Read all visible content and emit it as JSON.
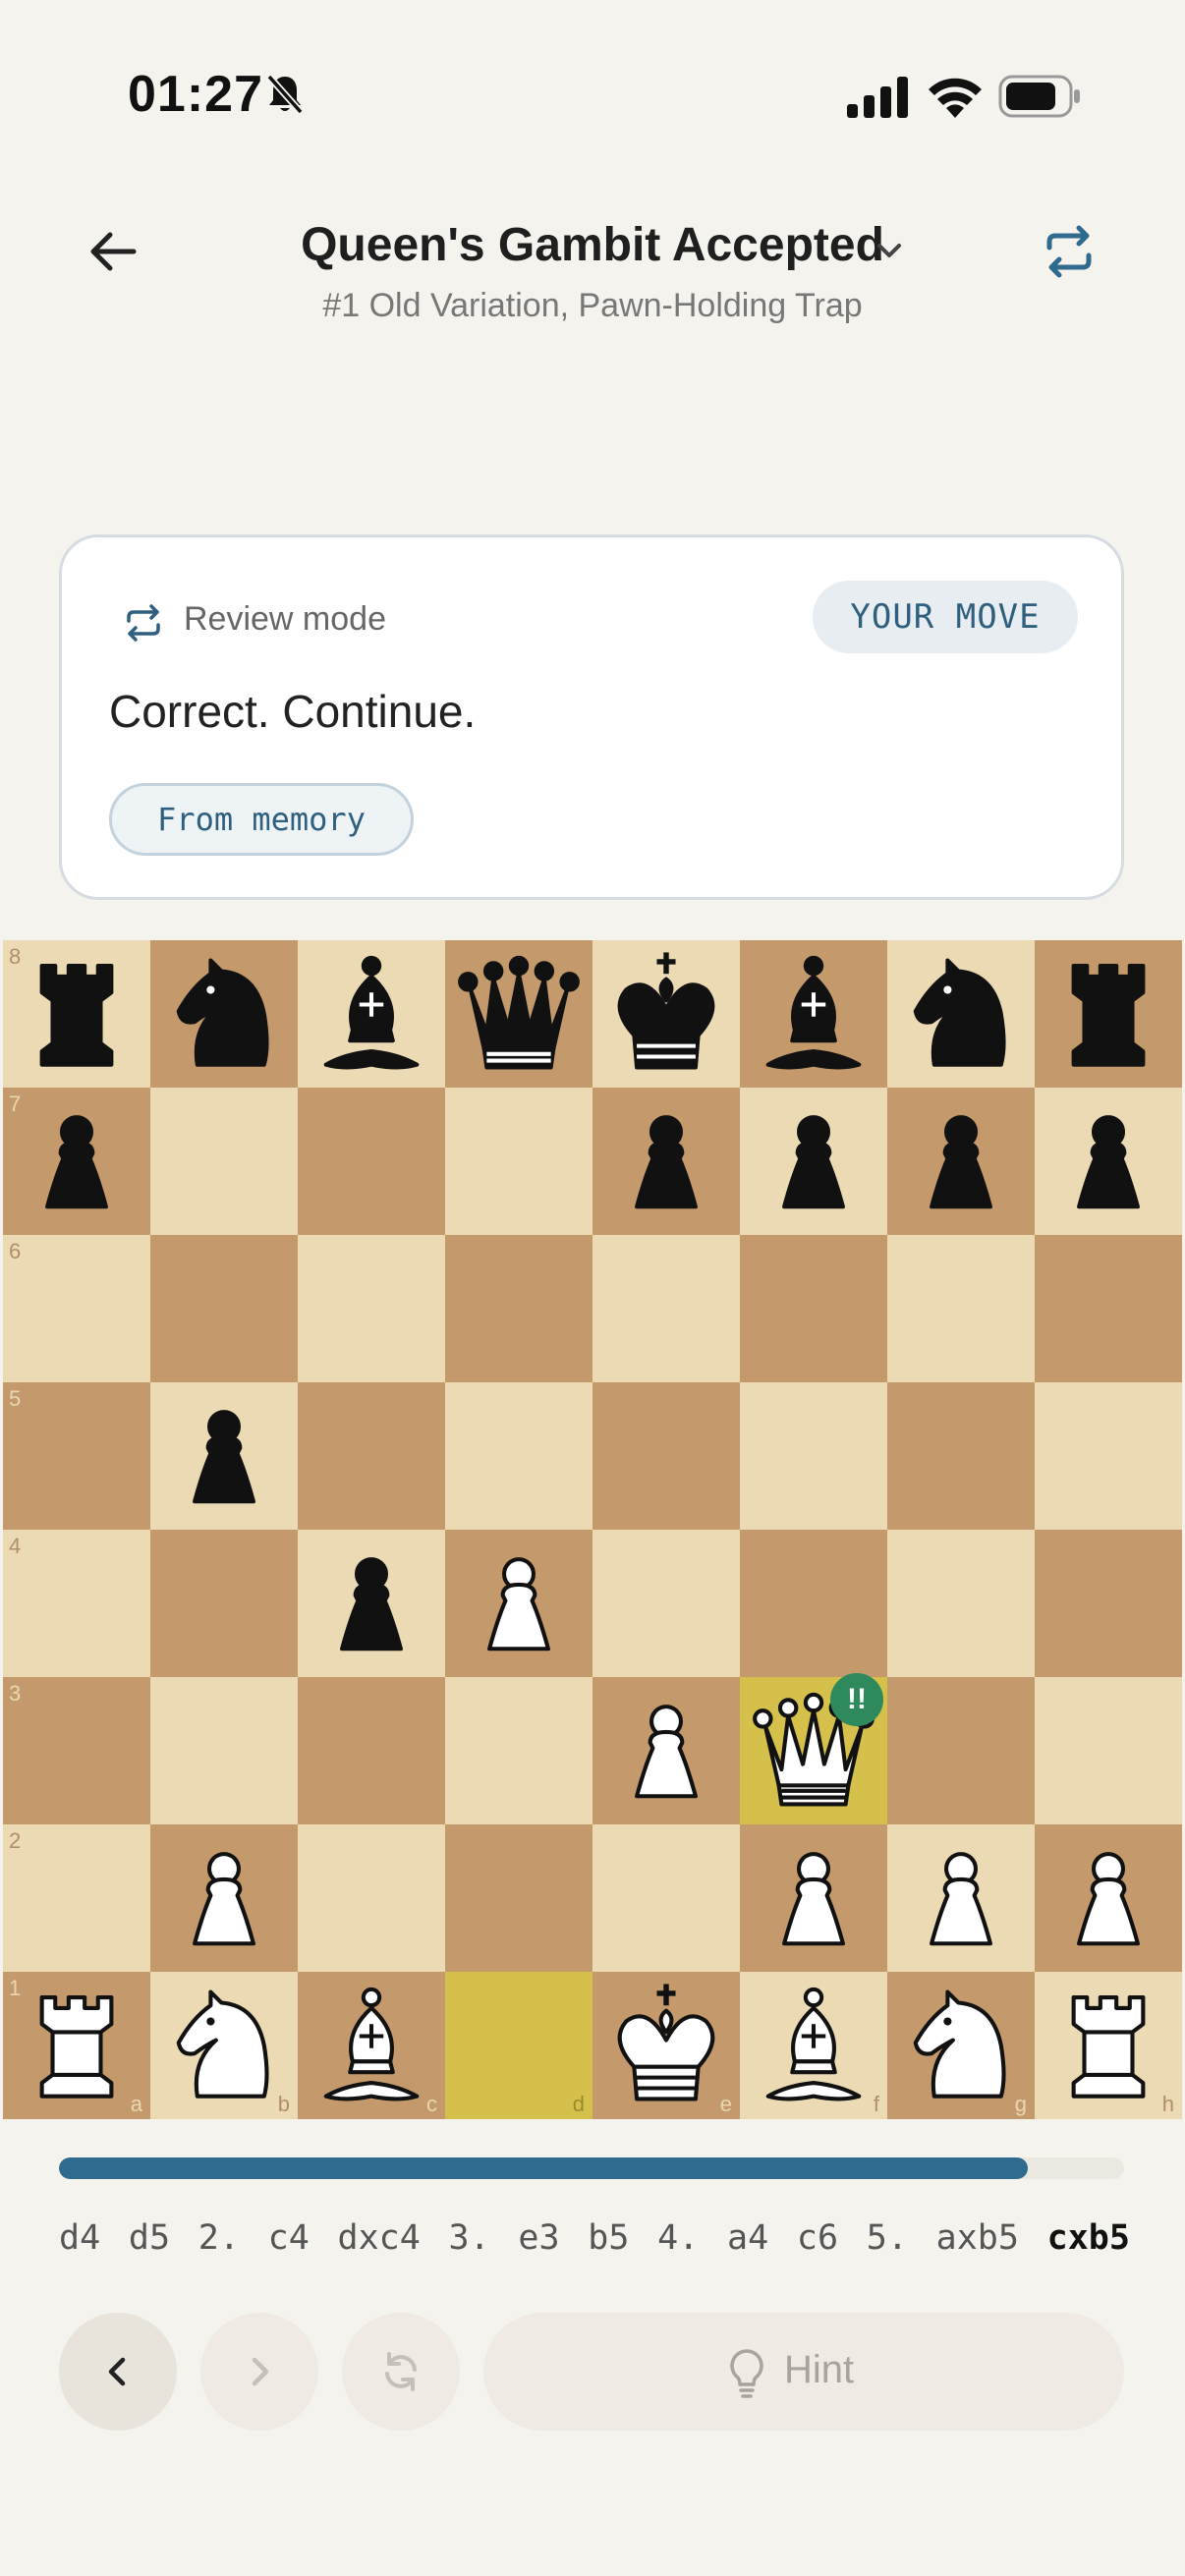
{
  "status_bar": {
    "time": "01:27"
  },
  "header": {
    "title": "Queen's Gambit Accepted",
    "subtitle": "#1 Old Variation, Pawn-Holding Trap"
  },
  "card": {
    "mode_label": "Review mode",
    "turn_badge": "YOUR MOVE",
    "feedback": "Correct. Continue.",
    "memory_chip": "From memory"
  },
  "board": {
    "ranks": [
      "8",
      "7",
      "6",
      "5",
      "4",
      "3",
      "2",
      "1"
    ],
    "files": [
      "a",
      "b",
      "c",
      "d",
      "e",
      "f",
      "g",
      "h"
    ],
    "position": [
      [
        "bR",
        "bN",
        "bB",
        "bQ",
        "bK",
        "bB",
        "bN",
        "bR"
      ],
      [
        "bP",
        "",
        "",
        "",
        "bP",
        "bP",
        "bP",
        "bP"
      ],
      [
        "",
        "",
        "",
        "",
        "",
        "",
        "",
        ""
      ],
      [
        "",
        "bP",
        "",
        "",
        "",
        "",
        "",
        ""
      ],
      [
        "",
        "",
        "bP",
        "wP",
        "",
        "",
        "",
        ""
      ],
      [
        "",
        "",
        "",
        "",
        "wP",
        "wQ",
        "",
        ""
      ],
      [
        "",
        "wP",
        "",
        "",
        "",
        "wP",
        "wP",
        "wP"
      ],
      [
        "wR",
        "wN",
        "wB",
        "",
        "wK",
        "wB",
        "wN",
        "wR"
      ]
    ],
    "highlighted_squares": [
      "d1",
      "f3"
    ],
    "annotation": {
      "square": "f3",
      "symbol": "!!"
    },
    "colors": {
      "light": "#ecdab5",
      "dark": "#c49a6c",
      "highlight": "#d4c04a",
      "annotation": "#2e8a5c"
    }
  },
  "progress": {
    "fraction": 0.91,
    "color": "#2f6b8e"
  },
  "moves": [
    "d4",
    "d5",
    "2.",
    "c4",
    "dxc4",
    "3.",
    "e3",
    "b5",
    "4.",
    "a4",
    "c6",
    "5.",
    "axb5",
    "cxb5"
  ],
  "current_move_index": 13,
  "controls": {
    "hint_label": "Hint"
  }
}
